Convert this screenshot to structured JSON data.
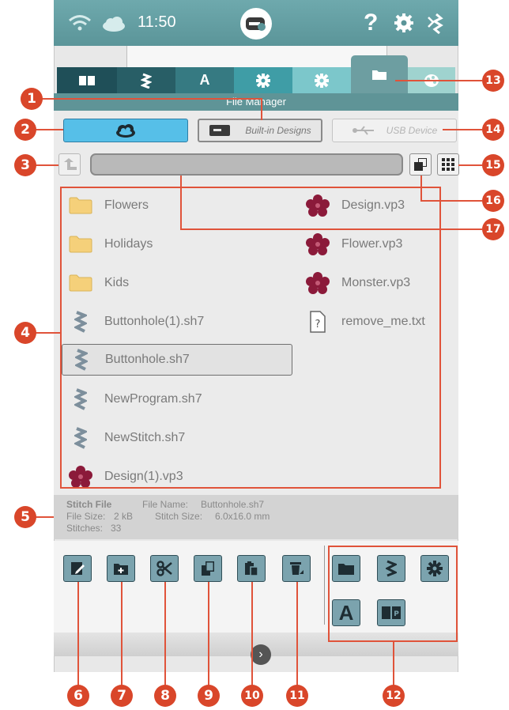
{
  "status": {
    "time": "11:50",
    "help": "?"
  },
  "header": {
    "title": "File Manager"
  },
  "sources": {
    "builtin_label": "Built-in Designs",
    "usb_label": "USB Device"
  },
  "files": [
    {
      "name": "Flowers",
      "icon": "folder-icon"
    },
    {
      "name": "Holidays",
      "icon": "folder-icon"
    },
    {
      "name": "Kids",
      "icon": "folder-icon"
    },
    {
      "name": "Buttonhole(1).sh7",
      "icon": "stitch-icon"
    },
    {
      "name": "Buttonhole.sh7",
      "icon": "stitch-icon",
      "selected": true
    },
    {
      "name": "NewProgram.sh7",
      "icon": "stitch-icon"
    },
    {
      "name": "NewStitch.sh7",
      "icon": "stitch-icon"
    },
    {
      "name": "Design(1).vp3",
      "icon": "flower-icon"
    },
    {
      "name": "Design.vp3",
      "icon": "flower-icon"
    },
    {
      "name": "Flower.vp3",
      "icon": "flower-icon"
    },
    {
      "name": "Monster.vp3",
      "icon": "flower-icon"
    },
    {
      "name": "remove_me.txt",
      "icon": "unknown-file-icon"
    }
  ],
  "info": {
    "type": "Stitch File",
    "file_name_label": "File Name:",
    "file_name": "Buttonhole.sh7",
    "file_size_label": "File Size:",
    "file_size": "2 kB",
    "stitch_size_label": "Stitch Size:",
    "stitch_size": "6.0x16.0 mm",
    "stitches_label": "Stitches:",
    "stitches": "33"
  },
  "tabs": [
    {
      "name": "book-icon"
    },
    {
      "name": "stitch-icon"
    },
    {
      "name": "letter-a-icon",
      "label": "A"
    },
    {
      "name": "settings-icon"
    },
    {
      "name": "machine-settings-icon"
    },
    {
      "name": "folder-icon"
    },
    {
      "name": "palette-icon"
    }
  ],
  "toolbar": {
    "left": [
      "edit-icon",
      "new-folder-icon",
      "cut-icon",
      "copy-icon",
      "paste-icon",
      "delete-icon"
    ],
    "quick": [
      "folder-icon",
      "stitch-icon",
      "settings-icon",
      "letter-a-icon",
      "p-book-icon"
    ],
    "quick_letter": "A",
    "quick_book_letter": "P"
  },
  "callouts": [
    "1",
    "2",
    "3",
    "4",
    "5",
    "6",
    "7",
    "8",
    "9",
    "10",
    "11",
    "12",
    "13",
    "14",
    "15",
    "16",
    "17"
  ],
  "colors": {
    "accent": "#5b9599",
    "callout": "#d9462a",
    "tool": "#7ba3ae",
    "design": "#8b1a3a"
  }
}
